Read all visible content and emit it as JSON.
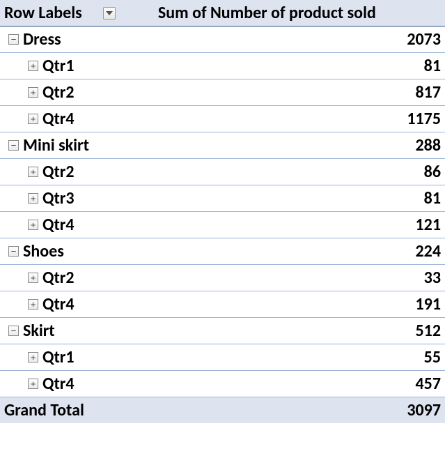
{
  "header": {
    "row_labels": "Row Labels",
    "value_header": "Sum of Number of product sold"
  },
  "groups": [
    {
      "label": "Dress",
      "total": "2073",
      "rows": [
        {
          "label": "Qtr1",
          "value": "81"
        },
        {
          "label": "Qtr2",
          "value": "817"
        },
        {
          "label": "Qtr4",
          "value": "1175"
        }
      ]
    },
    {
      "label": "Mini skirt",
      "total": "288",
      "rows": [
        {
          "label": "Qtr2",
          "value": "86"
        },
        {
          "label": "Qtr3",
          "value": "81"
        },
        {
          "label": "Qtr4",
          "value": "121"
        }
      ]
    },
    {
      "label": "Shoes",
      "total": "224",
      "rows": [
        {
          "label": "Qtr2",
          "value": "33"
        },
        {
          "label": "Qtr4",
          "value": "191"
        }
      ]
    },
    {
      "label": "Skirt",
      "total": "512",
      "rows": [
        {
          "label": "Qtr1",
          "value": "55"
        },
        {
          "label": "Qtr4",
          "value": "457"
        }
      ]
    }
  ],
  "grand_total": {
    "label": "Grand Total",
    "value": "3097"
  },
  "icons": {
    "collapse": "−",
    "expand": "+"
  }
}
